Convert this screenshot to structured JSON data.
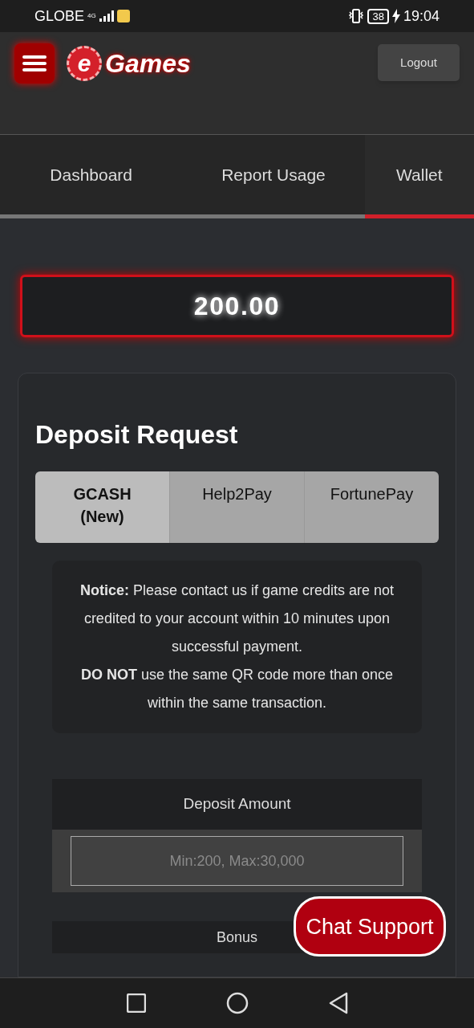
{
  "status_bar": {
    "carrier": "GLOBE",
    "network": "4G",
    "battery": "38",
    "time": "19:04"
  },
  "header": {
    "logo_mark": "e",
    "logo_text": "Games",
    "logout": "Logout"
  },
  "tabs": [
    {
      "label": "Dashboard",
      "selected": false
    },
    {
      "label": "Report Usage",
      "selected": false
    },
    {
      "label": "Wallet",
      "selected": true
    }
  ],
  "balance": "200.00",
  "deposit": {
    "title": "Deposit Request",
    "methods": [
      {
        "label": "GCASH (New)",
        "selected": true
      },
      {
        "label": "Help2Pay",
        "selected": false
      },
      {
        "label": "FortunePay",
        "selected": false
      }
    ],
    "notice": [
      "**Notice:** Please contact us if game credits are not credited to your account within 10 minutes upon successful payment.",
      "**DO NOT** use the same QR code more than once within the same transaction."
    ],
    "amount_label": "Deposit Amount",
    "amount_placeholder": "Min:200, Max:30,000",
    "bonus_label": "Bonus"
  },
  "chat_button": "Chat Support"
}
